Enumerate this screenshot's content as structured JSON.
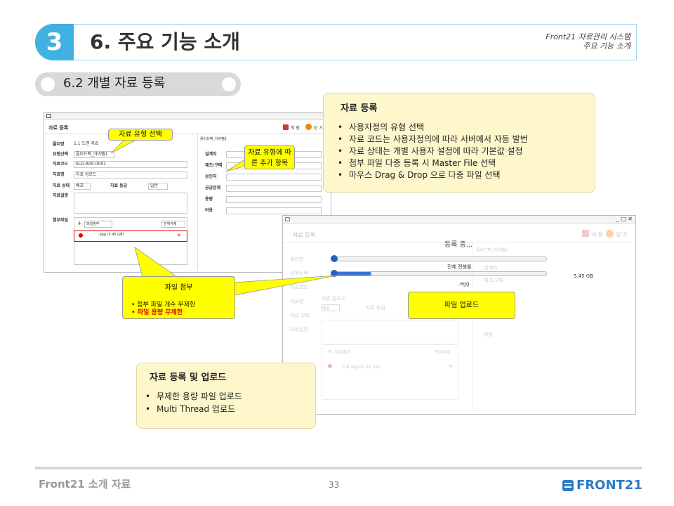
{
  "header": {
    "number": "3",
    "title": "6. 주요 기능 소개",
    "right_line1": "Front21 자료관리 시스템",
    "right_line2": "주요 기능 소개"
  },
  "section": {
    "title": "6.2 개별 자료 등록"
  },
  "window1": {
    "title": "자료 등록",
    "save": "저 장",
    "close": "닫 기",
    "fields": {
      "folder_label": "폴더명",
      "folder_value": "1.1 도면 자료",
      "type_label": "유형선택",
      "type_value": "플러드팩_아이템1",
      "code_label": "자료코드",
      "code_value": "SLD-A00-0001",
      "name_label": "자료명",
      "name_value": "자료 업로드",
      "status_label": "자료 상태",
      "status_value": "배포",
      "grade_label": "자료 등급",
      "grade_value": "일반",
      "desc_label": "자료설명",
      "attach_label": "첨부파일",
      "add_file": "파일첨부",
      "delete_all": "전체삭제",
      "file_name": ".egg (5.45 GB)"
    },
    "right_panel": {
      "title": "플러드팩_아이템1",
      "rows": [
        "설계자",
        "제조/구매",
        "승인자",
        "공급업체",
        "용량",
        "비용"
      ]
    }
  },
  "window2": {
    "title": "자료 등록",
    "progress_title": "등록 중...",
    "total_progress": "전체 진행률",
    "file_name": ".egg",
    "size": "5.45 GB",
    "progress_file": 0.0,
    "progress_total": 0.18,
    "save": "저 장",
    "close": "닫 기",
    "labels": [
      "폴더명",
      "유형선택",
      "자료코드",
      "자료명",
      "자료 상태",
      "자료설명",
      "첨부파일"
    ],
    "grade_label": "자료 등급",
    "status_value": "배포",
    "name_value": "자료 업로드",
    "add_file": "파일첨부",
    "delete_all": "전체삭제",
    "right_title": "플러드팩_아이템1",
    "right_rows": [
      "설계자",
      "제조/구매",
      "비용"
    ],
    "file_row": "자료.egg (5.45 GB)"
  },
  "callouts": {
    "main": {
      "title": "자료 등록",
      "items": [
        "사용자정의 유형 선택",
        "자료 코드는 사용자정의에 따라 서버에서 자동 발번",
        "자료 상태는 개별 사용자 설정에 따라 기본값 설정",
        "첨부 파일 다중 등록 시 Master File 선택",
        "마우스 Drag & Drop 으로 다중 파일 선택"
      ]
    },
    "type_select": "자료 유형 선택",
    "type_items": "자료 유형에 따\n른 추가 항목",
    "attach": {
      "title": "파일 첨부",
      "item1": "첨부 파일 개수 무제한",
      "item2": "파일 용량 무제한"
    },
    "upload": "파일 업로드",
    "bottom": {
      "title": "자료 등록 및 업로드",
      "items": [
        "무제한 용량 파일 업로드",
        "Multi Thread 업로드"
      ]
    }
  },
  "footer": {
    "left": "Front21 소개 자료",
    "page": "33",
    "logo": "FRONT21"
  },
  "colors": {
    "accent": "#40b1e0",
    "callout_yellow": "#ffff00",
    "callout_cream": "#fff7cc",
    "logo": "#2a7cc7",
    "red": "#e00000"
  }
}
